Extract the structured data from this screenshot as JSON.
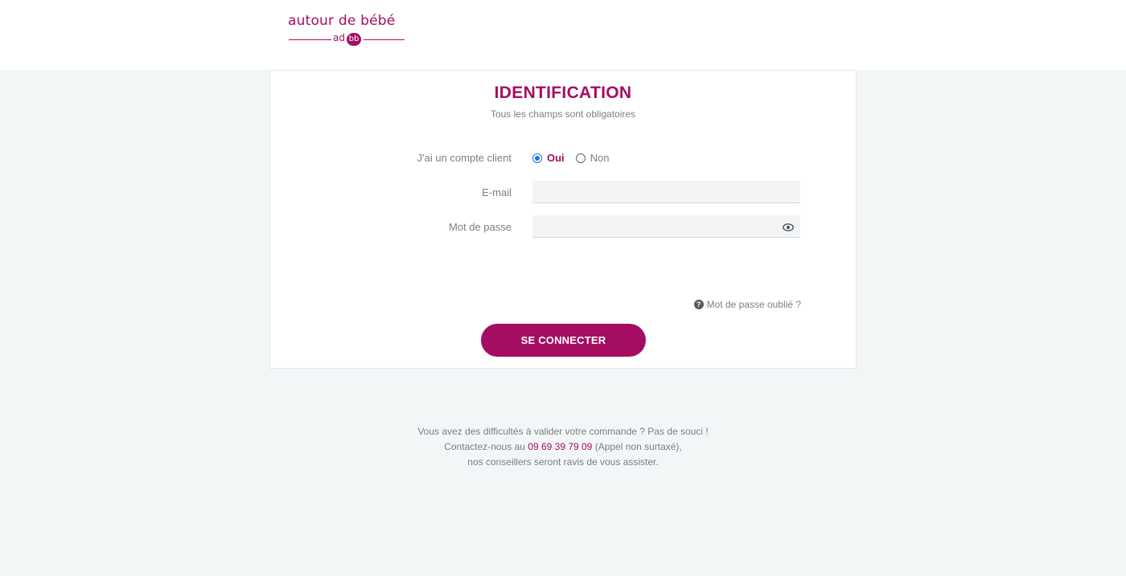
{
  "header": {
    "logo": {
      "wordmark": "autour de bébé",
      "ad": "ad",
      "bb": "bb"
    }
  },
  "form": {
    "title": "IDENTIFICATION",
    "subtitle": "Tous les champs sont obligatoires",
    "account_label": "J'ai un compte client",
    "account_options": [
      {
        "label": "Oui",
        "selected": true
      },
      {
        "label": "Non",
        "selected": false
      }
    ],
    "email_label": "E-mail",
    "email_value": "",
    "email_placeholder": "",
    "password_label": "Mot de passe",
    "password_value": "",
    "password_placeholder": "",
    "forgot_password": "Mot de passe oublié ?",
    "submit_label": "SE CONNECTER"
  },
  "help": {
    "line1": "Vous avez des difficultés à valider votre commande ? Pas de souci !",
    "line2_prefix": "Contactez-nous au ",
    "phone": "09 69 39 79 09",
    "line2_suffix": " (Appel non surtaxé),",
    "line3": "nos conseillers seront ravis de vous assister."
  },
  "colors": {
    "brand": "#a50d63",
    "background": "#f3f6f7",
    "radio_selected": "#1a73e8"
  },
  "icons": {
    "eye": "eye-icon",
    "help": "question-circle-icon"
  }
}
